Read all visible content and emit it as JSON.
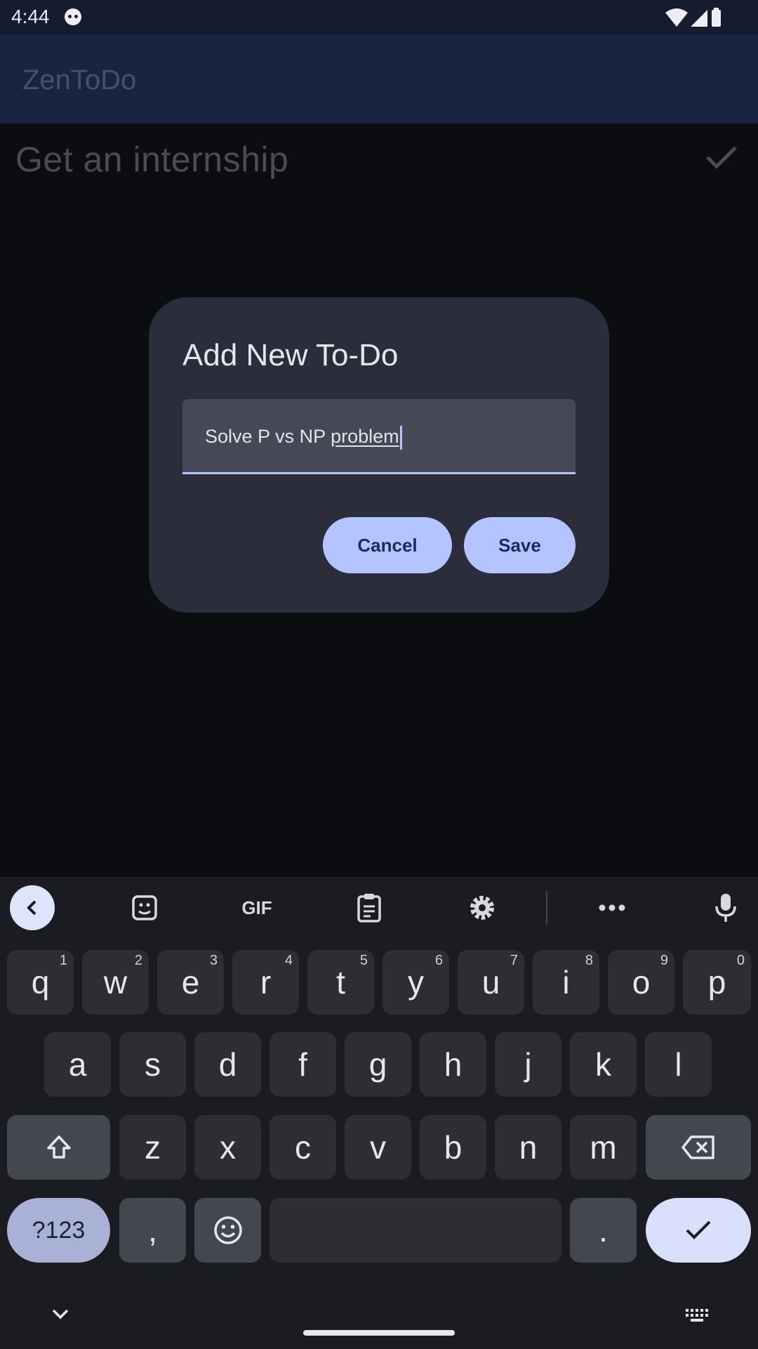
{
  "status_bar": {
    "time": "4:44"
  },
  "app": {
    "title": "ZenToDo"
  },
  "todo_list": [
    {
      "text": "Get an internship"
    }
  ],
  "dialog": {
    "title": "Add New To-Do",
    "input_value_plain": "Solve P vs NP ",
    "input_value_composing": "problem",
    "cancel_label": "Cancel",
    "save_label": "Save",
    "accent_color": "#b4c4ff"
  },
  "keyboard": {
    "toolbar": [
      "back-icon",
      "sticker-icon",
      "GIF",
      "clipboard-icon",
      "gear-icon",
      "more-icon",
      "mic-icon"
    ],
    "gif_label": "GIF",
    "row1": [
      {
        "key": "q",
        "hint": "1"
      },
      {
        "key": "w",
        "hint": "2"
      },
      {
        "key": "e",
        "hint": "3"
      },
      {
        "key": "r",
        "hint": "4"
      },
      {
        "key": "t",
        "hint": "5"
      },
      {
        "key": "y",
        "hint": "6"
      },
      {
        "key": "u",
        "hint": "7"
      },
      {
        "key": "i",
        "hint": "8"
      },
      {
        "key": "o",
        "hint": "9"
      },
      {
        "key": "p",
        "hint": "0"
      }
    ],
    "row2": [
      "a",
      "s",
      "d",
      "f",
      "g",
      "h",
      "j",
      "k",
      "l"
    ],
    "row3": [
      "z",
      "x",
      "c",
      "v",
      "b",
      "n",
      "m"
    ],
    "symbols_label": "?123",
    "comma_label": ",",
    "period_label": "."
  }
}
